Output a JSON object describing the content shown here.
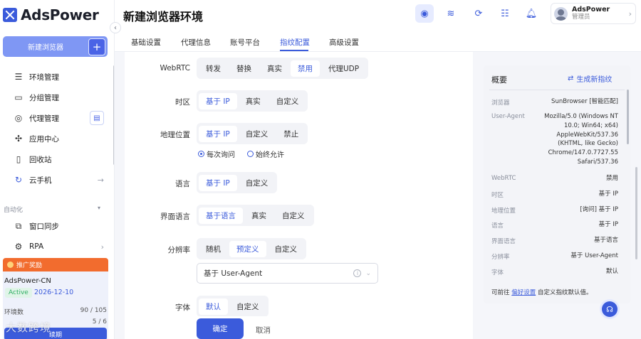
{
  "brand": {
    "name": "AdsPower"
  },
  "sidebar": {
    "new_browser_label": "新建浏览器",
    "items": [
      {
        "label": "环境管理",
        "icon": "list-icon"
      },
      {
        "label": "分组管理",
        "icon": "folder-icon"
      },
      {
        "label": "代理管理",
        "icon": "proxy-icon"
      },
      {
        "label": "应用中心",
        "icon": "puzzle-icon"
      },
      {
        "label": "回收站",
        "icon": "trash-icon"
      },
      {
        "label": "云手机",
        "icon": "cloud-phone-icon"
      }
    ],
    "section_label": "自动化",
    "auto_items": [
      {
        "label": "窗口同步",
        "icon": "sync-icon"
      },
      {
        "label": "RPA",
        "icon": "rpa-icon"
      }
    ],
    "promo_label": "推广奖励",
    "account": {
      "name": "AdsPower-CN",
      "status": "Active",
      "expiry": "2026-12-10",
      "env_label": "环境数",
      "env_value": "90 / 105",
      "member_value": "5 / 6",
      "renew_label": "续期"
    },
    "watermark": "大数跨境"
  },
  "header": {
    "title": "新建浏览器环境",
    "user": {
      "name": "AdsPower",
      "role": "管理员"
    }
  },
  "tabs": [
    "基础设置",
    "代理信息",
    "账号平台",
    "指纹配置",
    "高级设置"
  ],
  "form": {
    "webrtc": {
      "label": "WebRTC",
      "options": [
        "转发",
        "替换",
        "真实",
        "禁用",
        "代理UDP"
      ],
      "selected": 3
    },
    "timezone": {
      "label": "时区",
      "options": [
        "基于 IP",
        "真实",
        "自定义"
      ],
      "selected": 0
    },
    "geo": {
      "label": "地理位置",
      "options": [
        "基于 IP",
        "自定义",
        "禁止"
      ],
      "selected": 0,
      "radios": [
        "每次询问",
        "始终允许"
      ],
      "radio_selected": 0
    },
    "language": {
      "label": "语言",
      "options": [
        "基于 IP",
        "自定义"
      ],
      "selected": 0
    },
    "ui_language": {
      "label": "界面语言",
      "options": [
        "基于语言",
        "真实",
        "自定义"
      ],
      "selected": 0
    },
    "resolution": {
      "label": "分辨率",
      "options": [
        "随机",
        "预定义",
        "自定义"
      ],
      "selected": 1,
      "select_value": "基于 User-Agent"
    },
    "font": {
      "label": "字体",
      "options": [
        "默认",
        "自定义"
      ],
      "selected": 0
    }
  },
  "footer": {
    "confirm": "确定",
    "cancel": "取消"
  },
  "overview": {
    "title": "概要",
    "generate": "生成新指纹",
    "rows": [
      {
        "k": "浏览器",
        "v": "SunBrowser [智能匹配]"
      },
      {
        "k": "User-Agent",
        "v": "Mozilla/5.0 (Windows NT\n10.0; Win64; x64)\nAppleWebKit/537.36\n(KHTML, like Gecko)\nChrome/147.0.7727.55\nSafari/537.36"
      },
      {
        "k": "WebRTC",
        "v": "禁用"
      },
      {
        "k": "时区",
        "v": "基于 IP"
      },
      {
        "k": "地理位置",
        "v": "[询问] 基于 IP"
      },
      {
        "k": "语言",
        "v": "基于 IP"
      },
      {
        "k": "界面语言",
        "v": "基于语言"
      },
      {
        "k": "分辨率",
        "v": "基于 User-Agent"
      },
      {
        "k": "字体",
        "v": "默认"
      }
    ],
    "foot_prefix": "可前往",
    "foot_link": "偏好设置",
    "foot_suffix": "自定义指纹默认值。"
  },
  "colors": {
    "accent": "#3b5bdb",
    "promo": "#f26c2e",
    "active": "#2fae63"
  }
}
